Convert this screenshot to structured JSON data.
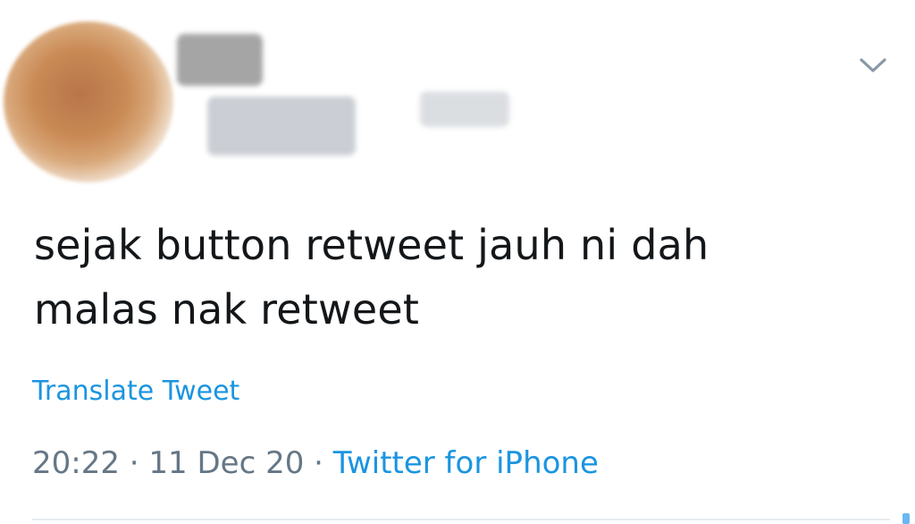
{
  "tweet": {
    "menu_icon": "chevron-down-icon",
    "text_lines": [
      "sejak button retweet jauh ni dah",
      "malas nak retweet"
    ],
    "translate_label": "Translate Tweet",
    "time": "20:22",
    "separator": "·",
    "date": "11 Dec 20",
    "source": "Twitter for iPhone"
  },
  "colors": {
    "text": "#14171a",
    "link": "#1b95e0",
    "meta": "#657786",
    "divider": "#e6ecf0"
  }
}
